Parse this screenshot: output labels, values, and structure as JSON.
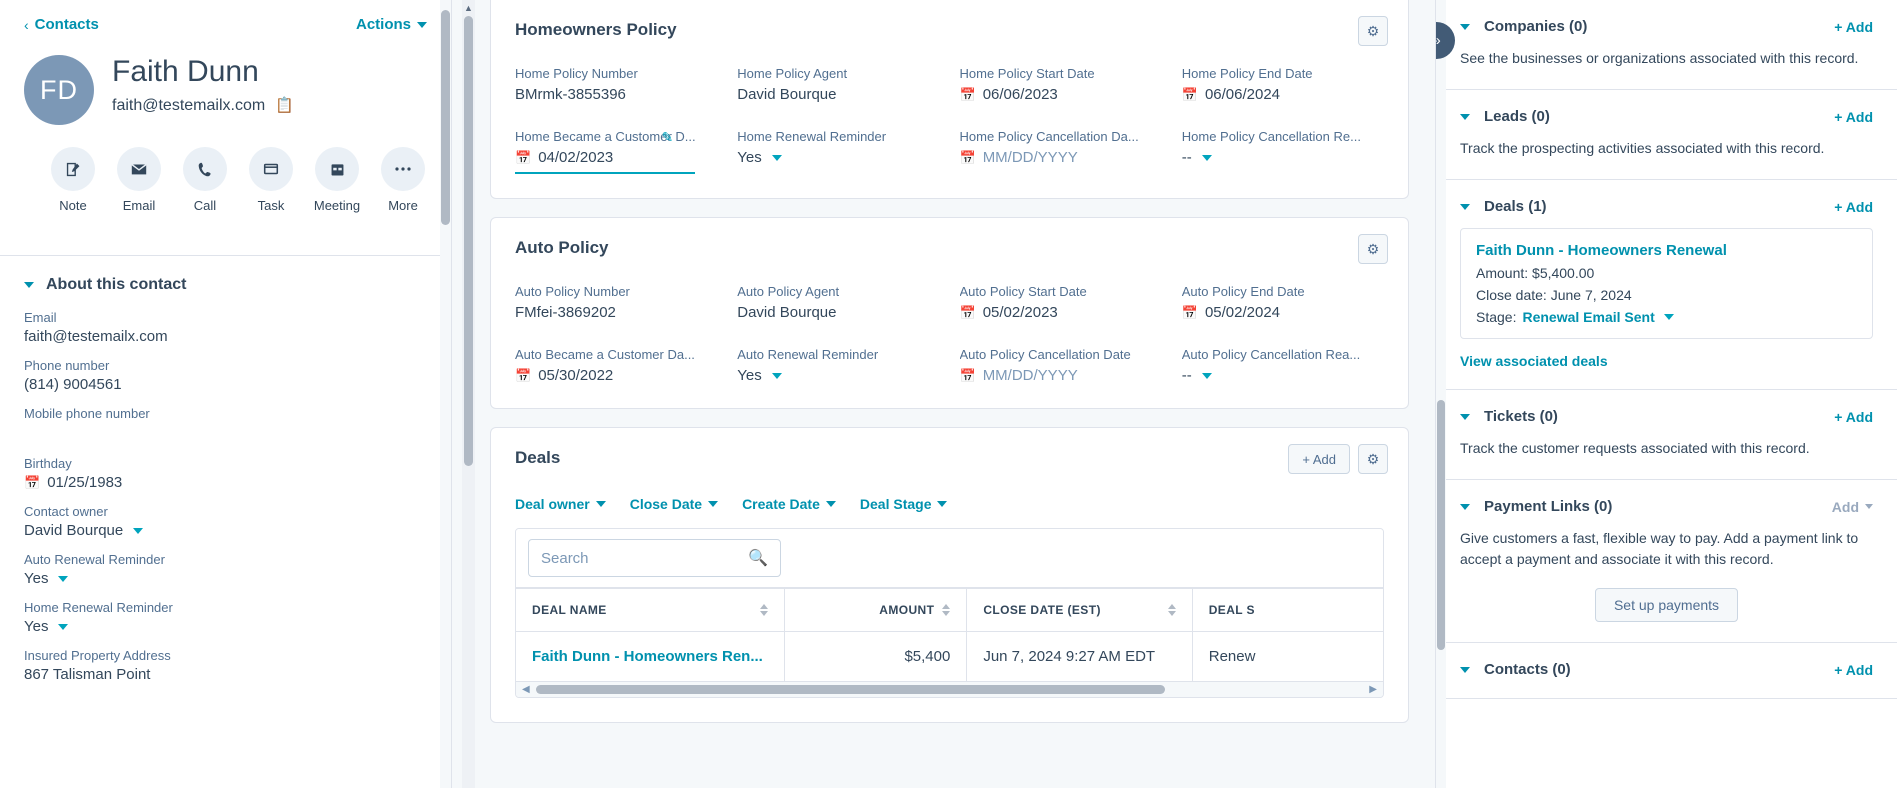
{
  "left": {
    "breadcrumb": "Contacts",
    "actions_label": "Actions",
    "avatar_initials": "FD",
    "name": "Faith Dunn",
    "email": "faith@testemailx.com",
    "quick_actions": [
      {
        "label": "Note",
        "icon": "note-icon"
      },
      {
        "label": "Email",
        "icon": "email-icon"
      },
      {
        "label": "Call",
        "icon": "call-icon"
      },
      {
        "label": "Task",
        "icon": "task-icon"
      },
      {
        "label": "Meeting",
        "icon": "meeting-icon"
      },
      {
        "label": "More",
        "icon": "more-icon"
      }
    ],
    "about_title": "About this contact",
    "fields": [
      {
        "label": "Email",
        "value": "faith@testemailx.com",
        "type": "text"
      },
      {
        "label": "Phone number",
        "value": "(814) 9004561",
        "type": "text"
      },
      {
        "label": "Mobile phone number",
        "value": "",
        "type": "text"
      },
      {
        "label": "Birthday",
        "value": "01/25/1983",
        "type": "date"
      },
      {
        "label": "Contact owner",
        "value": "David Bourque",
        "type": "select"
      },
      {
        "label": "Auto Renewal Reminder",
        "value": "Yes",
        "type": "select"
      },
      {
        "label": "Home Renewal Reminder",
        "value": "Yes",
        "type": "select"
      },
      {
        "label": "Insured Property Address",
        "value": "867 Talisman Point",
        "type": "text"
      }
    ]
  },
  "center": {
    "home_policy": {
      "title": "Homeowners Policy",
      "props": [
        {
          "label": "Home Policy Number",
          "value": "BMrmk-3855396",
          "type": "text"
        },
        {
          "label": "Home Policy Agent",
          "value": "David Bourque",
          "type": "text"
        },
        {
          "label": "Home Policy Start Date",
          "value": "06/06/2023",
          "type": "date"
        },
        {
          "label": "Home Policy End Date",
          "value": "06/06/2024",
          "type": "date"
        },
        {
          "label": "Home Became a Customer D...",
          "value": "04/02/2023",
          "type": "date",
          "active": true
        },
        {
          "label": "Home Renewal Reminder",
          "value": "Yes",
          "type": "select"
        },
        {
          "label": "Home Policy Cancellation Da...",
          "value": "MM/DD/YYYY",
          "type": "date",
          "placeholder": true
        },
        {
          "label": "Home Policy Cancellation Re...",
          "value": "--",
          "type": "select"
        }
      ]
    },
    "auto_policy": {
      "title": "Auto Policy",
      "props": [
        {
          "label": "Auto Policy Number",
          "value": "FMfei-3869202",
          "type": "text"
        },
        {
          "label": "Auto Policy Agent",
          "value": "David Bourque",
          "type": "text"
        },
        {
          "label": "Auto Policy Start Date",
          "value": "05/02/2023",
          "type": "date"
        },
        {
          "label": "Auto Policy End Date",
          "value": "05/02/2024",
          "type": "date"
        },
        {
          "label": "Auto Became a Customer Da...",
          "value": "05/30/2022",
          "type": "date"
        },
        {
          "label": "Auto Renewal Reminder",
          "value": "Yes",
          "type": "select"
        },
        {
          "label": "Auto Policy Cancellation Date",
          "value": "MM/DD/YYYY",
          "type": "date",
          "placeholder": true
        },
        {
          "label": "Auto Policy Cancellation Rea...",
          "value": "--",
          "type": "select"
        }
      ]
    },
    "deals": {
      "title": "Deals",
      "add_label": "+ Add",
      "filters": [
        "Deal owner",
        "Close Date",
        "Create Date",
        "Deal Stage"
      ],
      "search_placeholder": "Search",
      "search_value": "",
      "columns": [
        "DEAL NAME",
        "AMOUNT",
        "CLOSE DATE (EST)",
        "DEAL S"
      ],
      "rows": [
        {
          "deal_name": "Faith Dunn - Homeowners Ren...",
          "amount": "$5,400",
          "close_date": "Jun 7, 2024 9:27 AM EDT",
          "deal_stage": "Renew"
        }
      ]
    }
  },
  "right": {
    "collapse_icon": "double-chevron-right-icon",
    "sections": [
      {
        "title": "Companies (0)",
        "add_label": "+ Add",
        "description": "See the businesses or organizations associated with this record."
      },
      {
        "title": "Leads (0)",
        "add_label": "+ Add",
        "description": "Track the prospecting activities associated with this record."
      },
      {
        "title": "Deals (1)",
        "add_label": "+ Add",
        "card": {
          "name": "Faith Dunn - Homeowners Renewal",
          "amount": "Amount: $5,400.00",
          "close_date": "Close date: June 7, 2024",
          "stage_label": "Stage:",
          "stage_value": "Renewal Email Sent"
        },
        "view_link": "View associated deals"
      },
      {
        "title": "Tickets (0)",
        "add_label": "+ Add",
        "description": "Track the customer requests associated with this record."
      },
      {
        "title": "Payment Links (0)",
        "add_label": "Add",
        "add_muted": true,
        "description": "Give customers a fast, flexible way to pay. Add a payment link to accept a payment and associate it with this record.",
        "button_label": "Set up payments"
      },
      {
        "title": "Contacts (0)",
        "add_label": "+ Add"
      }
    ]
  },
  "colors": {
    "accent": "#0091ae",
    "teal": "#00a4bd",
    "text": "#33475b",
    "muted": "#516f90",
    "border": "#dfe3eb",
    "bg": "#f5f8fa",
    "avatar": "#7c98b6",
    "pill": "#425b76"
  }
}
